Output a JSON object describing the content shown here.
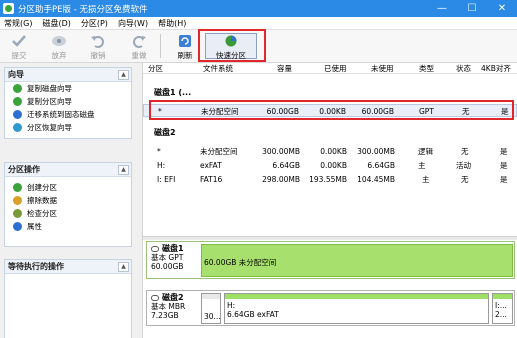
{
  "window": {
    "title": "分区助手PE版 - 无损分区免费软件",
    "controls": [
      "—",
      "☐",
      "✕"
    ]
  },
  "menu": [
    "常规(G)",
    "磁盘(D)",
    "分区(P)",
    "向导(W)",
    "帮助(H)"
  ],
  "toolbar": {
    "items": [
      {
        "label": "提交",
        "icon": "check-icon"
      },
      {
        "label": "放弃",
        "icon": "discard-icon"
      },
      {
        "label": "撤销",
        "icon": "undo-icon"
      },
      {
        "label": "重做",
        "icon": "redo-icon"
      },
      {
        "label": "刷新",
        "icon": "refresh-icon"
      }
    ],
    "quick_partition": "快速分区"
  },
  "sidebar": {
    "wizard": {
      "title": "向导",
      "items": [
        "复制磁盘向导",
        "复制分区向导",
        "迁移系统到固态磁盘",
        "分区恢复向导"
      ]
    },
    "operations": {
      "title": "分区操作",
      "items": [
        "创建分区",
        "擦除数据",
        "检查分区",
        "属性"
      ]
    },
    "pending": {
      "title": "等待执行的操作"
    }
  },
  "table": {
    "headers": [
      "分区",
      "文件系统",
      "容量",
      "已使用",
      "未使用",
      "类型",
      "状态",
      "4KB对齐"
    ],
    "disk1": {
      "label": "磁盘1 (...",
      "rows": [
        {
          "partition": "*",
          "fs": "未分配空间",
          "capacity": "60.00GB",
          "used": "0.00KB",
          "free": "60.00GB",
          "type": "GPT",
          "status": "无",
          "align": "是"
        }
      ]
    },
    "disk2": {
      "label": "磁盘2",
      "rows": [
        {
          "partition": "*",
          "fs": "未分配空间",
          "capacity": "300.00MB",
          "used": "0.00KB",
          "free": "300.00MB",
          "type": "逻辑",
          "status": "无",
          "align": "是"
        },
        {
          "partition": "H:",
          "fs": "exFAT",
          "capacity": "6.64GB",
          "used": "0.00KB",
          "free": "6.64GB",
          "type": "主",
          "status": "活动",
          "align": "是"
        },
        {
          "partition": "I: EFI",
          "fs": "FAT16",
          "capacity": "298.00MB",
          "used": "193.55MB",
          "free": "104.45MB",
          "type": "主",
          "status": "无",
          "align": "是"
        }
      ]
    }
  },
  "diskmap": {
    "disk1": {
      "name": "磁盘1",
      "kind": "基本 GPT",
      "size": "60.00GB",
      "segment": "60.00GB 未分配空间"
    },
    "disk2": {
      "name": "磁盘2",
      "kind": "基本 MBR",
      "size": "7.23GB",
      "seg1": "30...",
      "seg2_name": "H:",
      "seg2_size": "6.64GB exFAT",
      "seg3_name": "I:...",
      "seg3_size": "2..."
    }
  },
  "colors": {
    "title_bar": "#2b8ae6",
    "highlight": "#e0282c",
    "unallocated": "#9ee065",
    "used_bar": "#9ee065"
  }
}
